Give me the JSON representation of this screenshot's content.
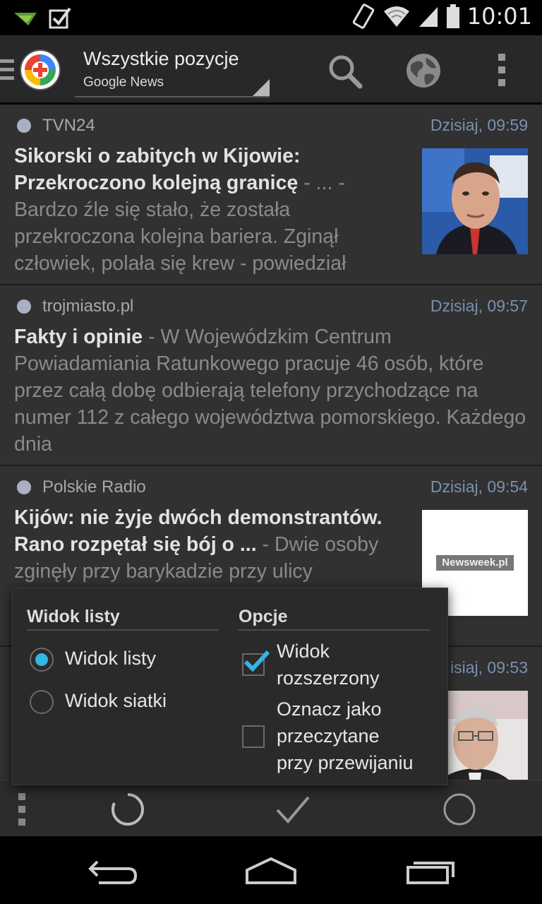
{
  "status_bar": {
    "time": "10:01",
    "left_icons": [
      "notification-icon",
      "checkbox-icon"
    ],
    "right_icons": [
      "vibrate-icon",
      "wifi-icon",
      "signal-icon",
      "battery-icon"
    ]
  },
  "action_bar": {
    "title": "Wszystkie pozycje",
    "subtitle": "Google News",
    "icons": [
      "drawer-icon",
      "app-logo",
      "search-icon",
      "globe-icon",
      "overflow-icon"
    ]
  },
  "articles": [
    {
      "source": "TVN24",
      "time": "Dzisiaj, 09:59",
      "headline": "Sikorski o zabitych w Kijowie: Przekroczono kolejną granicę",
      "snippet": " - ... - Bardzo źle się stało, że została przekroczona kolejna bariera. Zginął człowiek, polała się krew - powiedział",
      "has_thumb": true
    },
    {
      "source": "trojmiasto.pl",
      "time": "Dzisiaj, 09:57",
      "headline": "Fakty i opinie",
      "snippet": " - W Wojewódzkim Centrum Powiadamiania Ratunkowego pracuje 46 osób, które przez całą dobę odbierają telefony przychodzące na numer 112 z całego województwa pomorskiego. Każdego dnia",
      "has_thumb": false
    },
    {
      "source": "Polskie Radio",
      "time": "Dzisiaj, 09:54",
      "headline": "Kijów: nie żyje dwóch demonstrantów. Rano rozpętał się bój o ...",
      "snippet": " - Dwie osoby zginęły przy barykadzie przy ulicy",
      "thumb_text": "Newsweek.pl",
      "has_thumb": true
    },
    {
      "source": "",
      "time": "isiaj, 09:53",
      "headline": "",
      "snippet": "",
      "has_thumb": true
    }
  ],
  "popup": {
    "view_header": "Widok listy",
    "options_header": "Opcje",
    "radio_list": "Widok listy",
    "radio_grid": "Widok siatki",
    "selected_view": "Widok listy",
    "check_expanded_line1": "Widok",
    "check_expanded_line2": "rozszerzony",
    "check_expanded_checked": true,
    "check_mark_read_line1": "Oznacz jako",
    "check_mark_read_line2": "przeczytane",
    "check_mark_read_line3": "przy przewijaniu",
    "check_mark_read_checked": false
  },
  "bottom_bar": {
    "icons": [
      "menu-dots-icon",
      "refresh-spinner-icon",
      "mark-read-check-icon",
      "circle-icon"
    ]
  },
  "nav_bar": {
    "icons": [
      "back-icon",
      "home-icon",
      "recents-icon"
    ]
  },
  "colors": {
    "accent": "#33b5e5",
    "time_text": "#7a8fb0",
    "background": "#303030"
  }
}
